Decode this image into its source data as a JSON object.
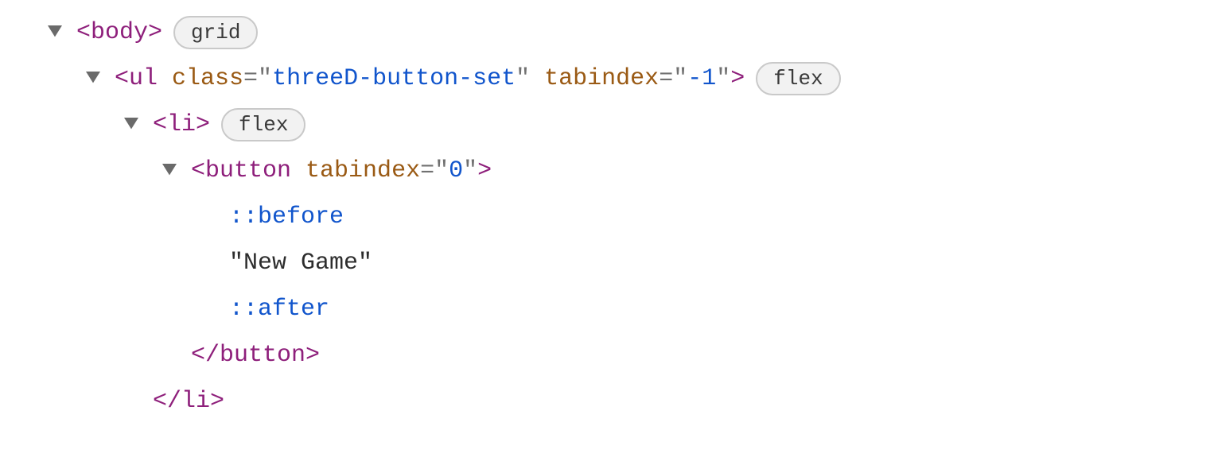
{
  "rows": [
    {
      "indent": 0,
      "arrow": true,
      "badge": "grid",
      "segs": [
        {
          "cls": "tag",
          "t": "<body>"
        }
      ]
    },
    {
      "indent": 1,
      "arrow": true,
      "badge": "flex",
      "segs": [
        {
          "cls": "tag",
          "t": "<ul"
        },
        {
          "cls": "",
          "t": " "
        },
        {
          "cls": "attr",
          "t": "class"
        },
        {
          "cls": "punc",
          "t": "=\""
        },
        {
          "cls": "val",
          "t": "threeD-button-set"
        },
        {
          "cls": "punc",
          "t": "\""
        },
        {
          "cls": "",
          "t": " "
        },
        {
          "cls": "attr",
          "t": "tabindex"
        },
        {
          "cls": "punc",
          "t": "=\""
        },
        {
          "cls": "val",
          "t": "-1"
        },
        {
          "cls": "punc",
          "t": "\""
        },
        {
          "cls": "tag",
          "t": ">"
        }
      ]
    },
    {
      "indent": 2,
      "arrow": true,
      "badge": "flex",
      "segs": [
        {
          "cls": "tag",
          "t": "<li>"
        }
      ]
    },
    {
      "indent": 3,
      "arrow": true,
      "segs": [
        {
          "cls": "tag",
          "t": "<button"
        },
        {
          "cls": "",
          "t": " "
        },
        {
          "cls": "attr",
          "t": "tabindex"
        },
        {
          "cls": "punc",
          "t": "=\""
        },
        {
          "cls": "val",
          "t": "0"
        },
        {
          "cls": "punc",
          "t": "\""
        },
        {
          "cls": "tag",
          "t": ">"
        }
      ]
    },
    {
      "indent": 4,
      "segs": [
        {
          "cls": "pseudo",
          "t": "::before"
        }
      ]
    },
    {
      "indent": 4,
      "segs": [
        {
          "cls": "text",
          "t": "\"New Game\""
        }
      ]
    },
    {
      "indent": 4,
      "segs": [
        {
          "cls": "pseudo",
          "t": "::after"
        }
      ]
    },
    {
      "indent": 3,
      "segs": [
        {
          "cls": "tag",
          "t": "</button>"
        }
      ]
    },
    {
      "indent": 2,
      "segs": [
        {
          "cls": "tag",
          "t": "</li>"
        }
      ]
    }
  ]
}
